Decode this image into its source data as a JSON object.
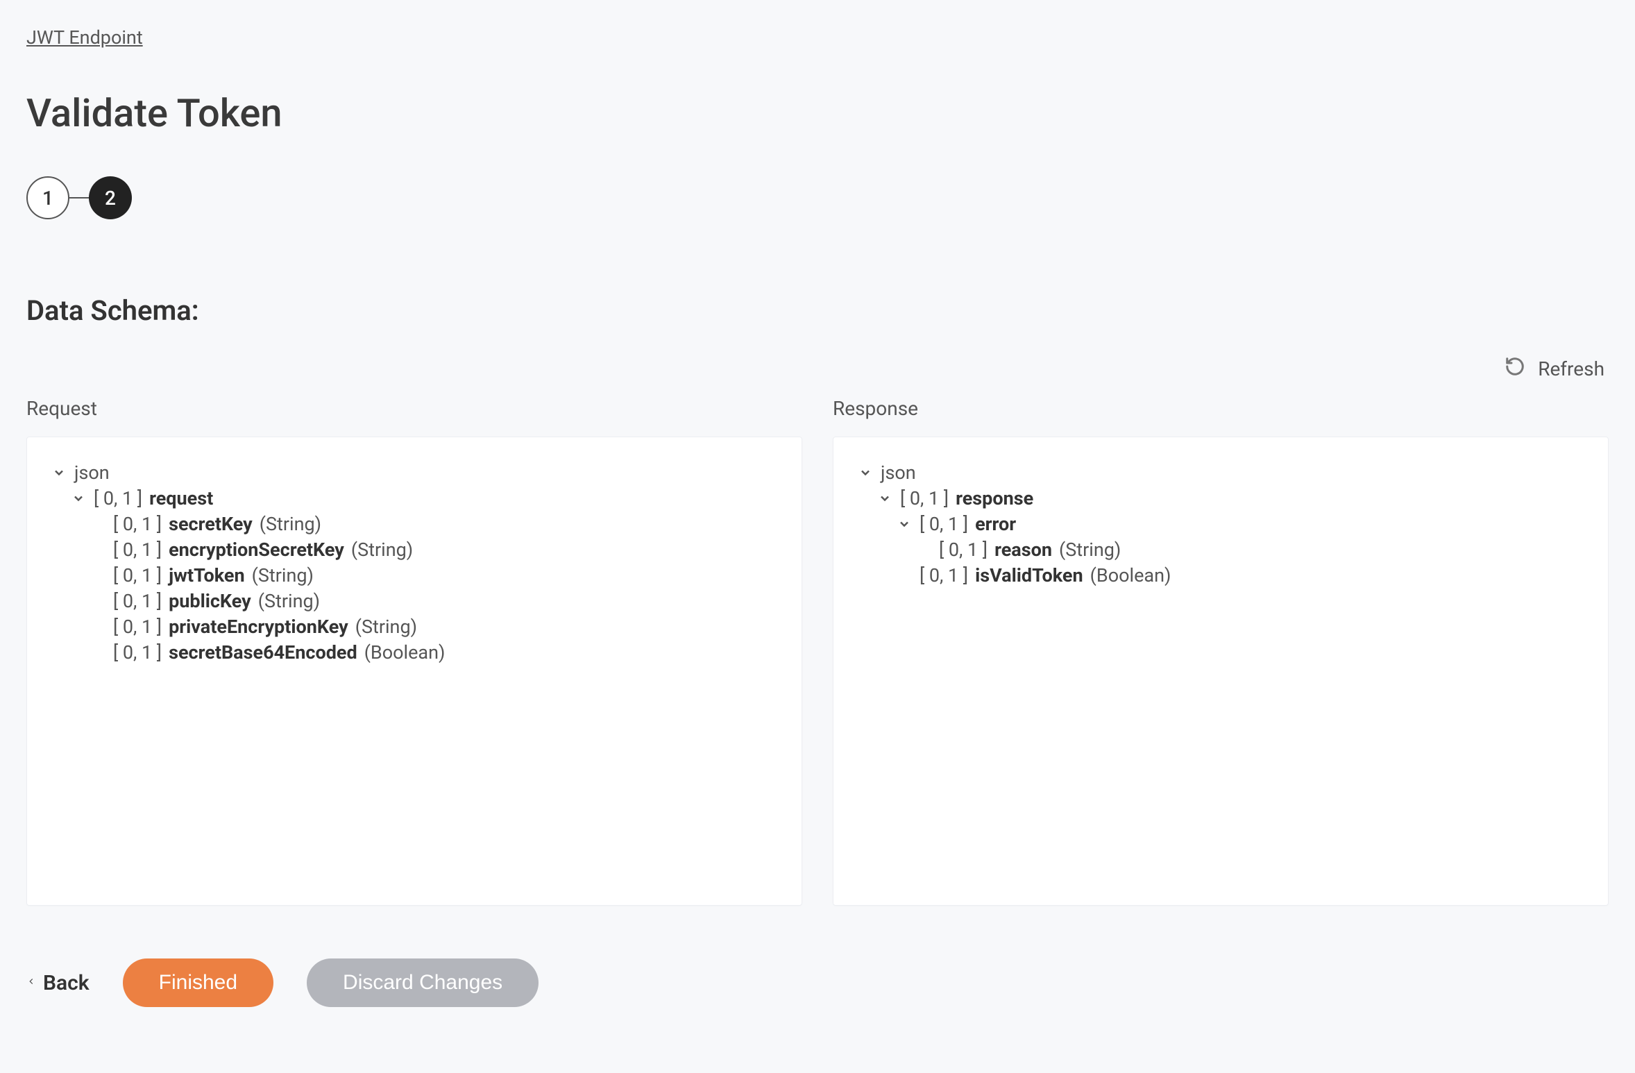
{
  "breadcrumb": "JWT Endpoint",
  "title": "Validate Token",
  "steps": {
    "one": "1",
    "two": "2"
  },
  "section_title": "Data Schema:",
  "refresh_label": "Refresh",
  "panels": {
    "request_title": "Request",
    "response_title": "Response"
  },
  "request_tree": {
    "root": "json",
    "group_card": "[ 0, 1 ]",
    "group_name": "request",
    "fields": [
      {
        "card": "[ 0, 1 ]",
        "name": "secretKey",
        "type": "(String)"
      },
      {
        "card": "[ 0, 1 ]",
        "name": "encryptionSecretKey",
        "type": "(String)"
      },
      {
        "card": "[ 0, 1 ]",
        "name": "jwtToken",
        "type": "(String)"
      },
      {
        "card": "[ 0, 1 ]",
        "name": "publicKey",
        "type": "(String)"
      },
      {
        "card": "[ 0, 1 ]",
        "name": "privateEncryptionKey",
        "type": "(String)"
      },
      {
        "card": "[ 0, 1 ]",
        "name": "secretBase64Encoded",
        "type": "(Boolean)"
      }
    ]
  },
  "response_tree": {
    "root": "json",
    "group_card": "[ 0, 1 ]",
    "group_name": "response",
    "error_card": "[ 0, 1 ]",
    "error_name": "error",
    "error_fields": [
      {
        "card": "[ 0, 1 ]",
        "name": "reason",
        "type": "(String)"
      }
    ],
    "trailing_fields": [
      {
        "card": "[ 0, 1 ]",
        "name": "isValidToken",
        "type": "(Boolean)"
      }
    ]
  },
  "footer": {
    "back": "Back",
    "finished": "Finished",
    "discard": "Discard Changes"
  }
}
